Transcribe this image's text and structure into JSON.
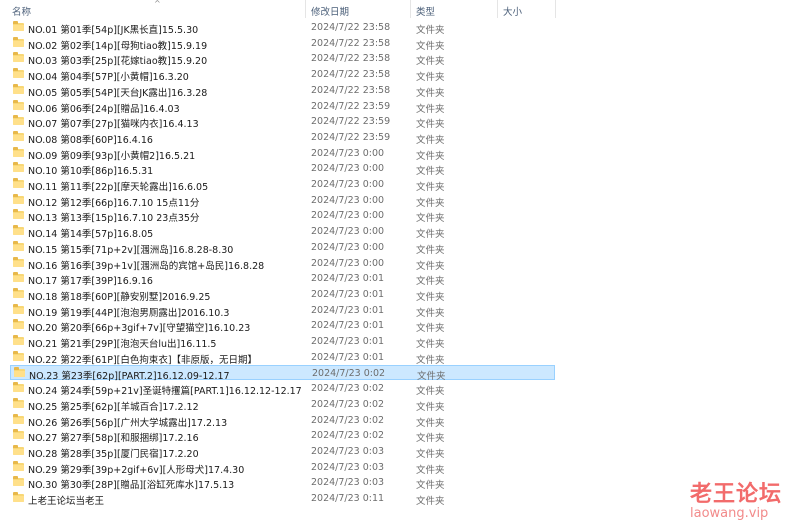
{
  "columns": {
    "name": "名称",
    "date": "修改日期",
    "type": "类型",
    "size": "大小",
    "sort_indicator": "^"
  },
  "folder_icon": "folder-icon",
  "selected_index": 23,
  "rows": [
    {
      "name": "NO.01 第01季[54p][JK黑长直]15.5.30",
      "date": "2024/7/22 23:58",
      "type": "文件夹"
    },
    {
      "name": "NO.02 第02季[14p][母狗tiao教]15.9.19",
      "date": "2024/7/22 23:58",
      "type": "文件夹"
    },
    {
      "name": "NO.03 第03季[25p][花嫁tiao教]15.9.20",
      "date": "2024/7/22 23:58",
      "type": "文件夹"
    },
    {
      "name": "NO.04 第04季[57P][小黄帽]16.3.20",
      "date": "2024/7/22 23:58",
      "type": "文件夹"
    },
    {
      "name": "NO.05 第05季[54P][天台JK露出]16.3.28",
      "date": "2024/7/22 23:58",
      "type": "文件夹"
    },
    {
      "name": "NO.06 第06季[24p][贈品]16.4.03",
      "date": "2024/7/22 23:59",
      "type": "文件夹"
    },
    {
      "name": "NO.07 第07季[27p][猫咪内衣]16.4.13",
      "date": "2024/7/22 23:59",
      "type": "文件夹"
    },
    {
      "name": "NO.08 第08季[60P]16.4.16",
      "date": "2024/7/22 23:59",
      "type": "文件夹"
    },
    {
      "name": "NO.09 第09季[93p][小黄帽2]16.5.21",
      "date": "2024/7/23 0:00",
      "type": "文件夹"
    },
    {
      "name": "NO.10 第10季[86p]16.5.31",
      "date": "2024/7/23 0:00",
      "type": "文件夹"
    },
    {
      "name": "NO.11 第11季[22p][摩天轮露出]16.6.05",
      "date": "2024/7/23 0:00",
      "type": "文件夹"
    },
    {
      "name": "NO.12 第12季[66p]16.7.10 15点11分",
      "date": "2024/7/23 0:00",
      "type": "文件夹"
    },
    {
      "name": "NO.13 第13季[15p]16.7.10 23点35分",
      "date": "2024/7/23 0:00",
      "type": "文件夹"
    },
    {
      "name": "NO.14 第14季[57p]16.8.05",
      "date": "2024/7/23 0:00",
      "type": "文件夹"
    },
    {
      "name": "NO.15 第15季[71p+2v][涠洲岛]16.8.28-8.30",
      "date": "2024/7/23 0:00",
      "type": "文件夹"
    },
    {
      "name": "NO.16 第16季[39p+1v][涠洲岛的宾馆+岛民]16.8.28",
      "date": "2024/7/23 0:00",
      "type": "文件夹"
    },
    {
      "name": "NO.17 第17季[39P]16.9.16",
      "date": "2024/7/23 0:01",
      "type": "文件夹"
    },
    {
      "name": "NO.18 第18季[60P][静安别墅]2016.9.25",
      "date": "2024/7/23 0:01",
      "type": "文件夹"
    },
    {
      "name": "NO.19 第19季[44P][泡泡男厕露出]2016.10.3",
      "date": "2024/7/23 0:01",
      "type": "文件夹"
    },
    {
      "name": "NO.20 第20季[66p+3gif+7v][守望猫空]16.10.23",
      "date": "2024/7/23 0:01",
      "type": "文件夹"
    },
    {
      "name": "NO.21 第21季[29P][泡泡天台lu出]16.11.5",
      "date": "2024/7/23 0:01",
      "type": "文件夹"
    },
    {
      "name": "NO.22 第22季[61P][白色拘束衣]【非原版，无日期】",
      "date": "2024/7/23 0:01",
      "type": "文件夹"
    },
    {
      "name": "NO.23 第23季[62p][PART.2]16.12.09-12.17",
      "date": "2024/7/23 0:02",
      "type": "文件夹"
    },
    {
      "name": "NO.24 第24季[59p+21v]圣诞特攫篇[PART.1]16.12.12-12.17",
      "date": "2024/7/23 0:02",
      "type": "文件夹"
    },
    {
      "name": "NO.25 第25季[62p][羊城百合]17.2.12",
      "date": "2024/7/23 0:02",
      "type": "文件夹"
    },
    {
      "name": "NO.26 第26季[56p][广州大学城露出]17.2.13",
      "date": "2024/7/23 0:02",
      "type": "文件夹"
    },
    {
      "name": "NO.27 第27季[58p][和服捆绑]17.2.16",
      "date": "2024/7/23 0:02",
      "type": "文件夹"
    },
    {
      "name": "NO.28 第28季[35p][厦门民宿]17.2.20",
      "date": "2024/7/23 0:03",
      "type": "文件夹"
    },
    {
      "name": "NO.29 第29季[39p+2gif+6v][人形母犬]17.4.30",
      "date": "2024/7/23 0:03",
      "type": "文件夹"
    },
    {
      "name": "NO.30 第30季[28P][贈品][浴缸死库水]17.5.13",
      "date": "2024/7/23 0:03",
      "type": "文件夹"
    },
    {
      "name": "上老王论坛当老王",
      "date": "2024/7/23 0:11",
      "type": "文件夹"
    }
  ],
  "watermark": {
    "title": "老王论坛",
    "url": "laowang.vip"
  }
}
